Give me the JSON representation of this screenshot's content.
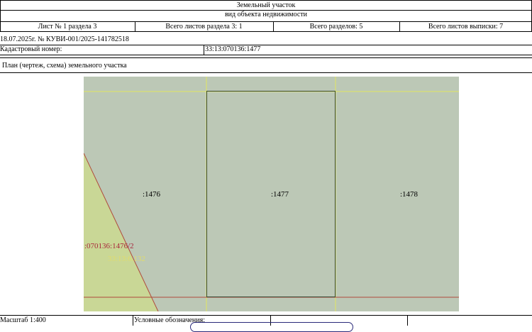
{
  "header": {
    "title": "Земельный участок",
    "subtitle": "вид объекта недвижимости"
  },
  "sheet_info": {
    "sheet": "Лист № 1 раздела 3",
    "total_sheets_section": "Всего листов раздела 3: 1",
    "total_sections": "Всего разделов: 5",
    "total_sheets_extract": "Всего листов выписки: 7"
  },
  "document_ref": "18.07.2025г. № КУВИ-001/2025-141782518",
  "cadastral": {
    "label": "Кадастровый номер:",
    "value": "33:13:070136:1477"
  },
  "plan_title": "План (чертеж, схема) земельного участка",
  "map": {
    "parcel_left": ":1476",
    "parcel_center": ":1477",
    "parcel_right": ":1478",
    "parcel_sub": ":070136:1476/2",
    "quarter": "33:13:6.132",
    "colors": {
      "background": "#bcc8b6",
      "green_area": "#c9d796",
      "yellow_line": "#e2e660",
      "red_line": "#b04a3c",
      "sub_label": "#a8283c",
      "quarter_label": "#e0dc6c"
    }
  },
  "footer": {
    "scale": "Масштаб 1:400",
    "legend": "Условные обозначения:"
  }
}
